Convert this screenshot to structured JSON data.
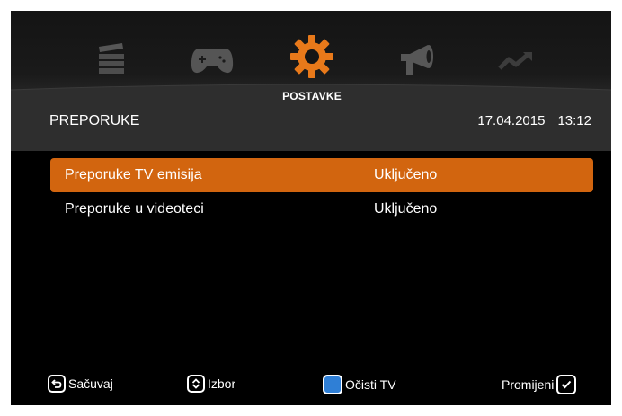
{
  "menu": {
    "active_label": "POSTAVKE",
    "icons": [
      "clapperboard-icon",
      "gamepad-icon",
      "gear-icon",
      "megaphone-icon",
      "trending-up-icon"
    ]
  },
  "header": {
    "title": "PREPORUKE",
    "date": "17.04.2015",
    "time": "13:12"
  },
  "settings": [
    {
      "label": "Preporuke TV emisija",
      "value": "Uključeno"
    },
    {
      "label": "Preporuke u videoteci",
      "value": "Uključeno"
    }
  ],
  "footer": {
    "save": "Sačuvaj",
    "select": "Izbor",
    "clear": "Očisti TV",
    "change": "Promijeni"
  },
  "colors": {
    "accent": "#d2650f",
    "blue_key": "#2f7fd6"
  }
}
